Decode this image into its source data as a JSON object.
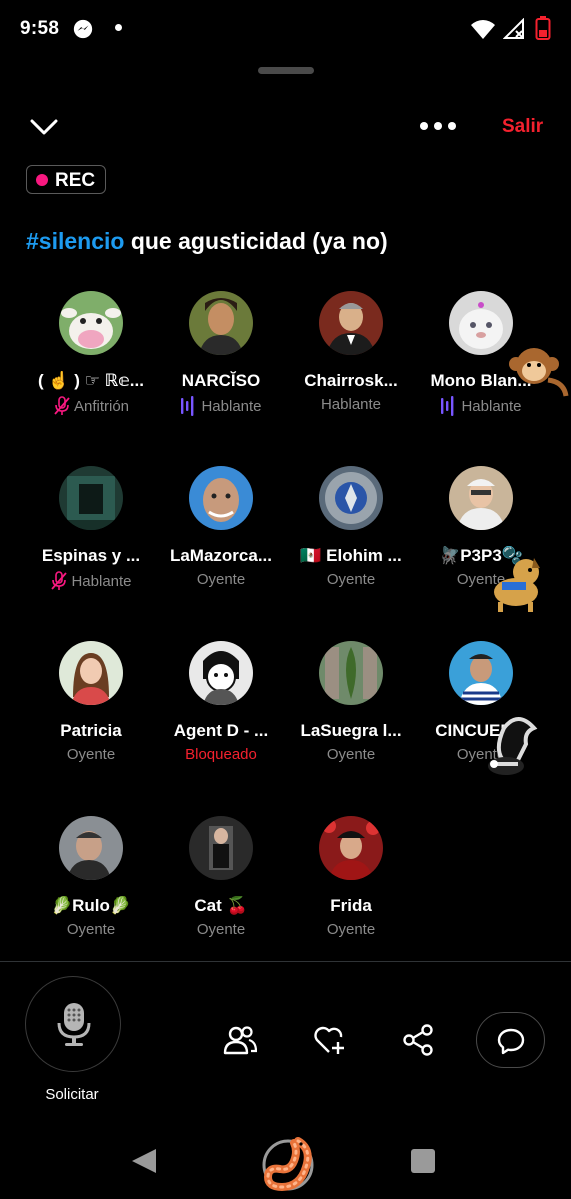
{
  "status_bar": {
    "time": "9:58"
  },
  "header": {
    "exit_label": "Salir"
  },
  "recording": {
    "label": "REC"
  },
  "space": {
    "hashtag": "#silencio",
    "title_rest": " que agusticidad (ya no)"
  },
  "participants": [
    {
      "name": "( ☝️ ) ☞ ℝ𝕖...",
      "role": "Anfitrión",
      "muted": true,
      "speaking": false
    },
    {
      "name": "ΝΑRCĬSO",
      "role": "Hablante",
      "muted": false,
      "speaking": true
    },
    {
      "name": "Chairrosk...",
      "role": "Hablante",
      "muted": false,
      "speaking": false
    },
    {
      "name": "Mono Blan...",
      "role": "Hablante",
      "muted": false,
      "speaking": true
    },
    {
      "name": "Espinas y ...",
      "role": "Hablante",
      "muted": true,
      "speaking": false
    },
    {
      "name": "LaMazorca...",
      "role": "Oyente",
      "muted": false,
      "speaking": false
    },
    {
      "name": "🇲🇽 Elohim ...",
      "role": "Oyente",
      "muted": false,
      "speaking": false
    },
    {
      "name": "🪰P3P3🫧",
      "role": "Oyente",
      "muted": false,
      "speaking": false
    },
    {
      "name": "Patricia",
      "role": "Oyente",
      "muted": false,
      "speaking": false
    },
    {
      "name": "Agent D - ...",
      "role": "Bloqueado",
      "muted": false,
      "speaking": false
    },
    {
      "name": "LaSuegra l...",
      "role": "Oyente",
      "muted": false,
      "speaking": false
    },
    {
      "name": "CINCUEN...",
      "role": "Oyente",
      "muted": false,
      "speaking": false
    },
    {
      "name": "🥬Rulo🥬",
      "role": "Oyente",
      "muted": false,
      "speaking": false
    },
    {
      "name": "Cat 🍒",
      "role": "Oyente",
      "muted": false,
      "speaking": false
    },
    {
      "name": "Frida",
      "role": "Oyente",
      "muted": false,
      "speaking": false
    }
  ],
  "controls": {
    "request_label": "Solicitar",
    "icons": [
      "people-icon",
      "heart-plus-icon",
      "share-icon",
      "chat-icon"
    ]
  },
  "colors": {
    "accent": "#1d9bf0",
    "danger": "#f4212e",
    "rec": "#f91880",
    "speaking": "#7856ff"
  }
}
